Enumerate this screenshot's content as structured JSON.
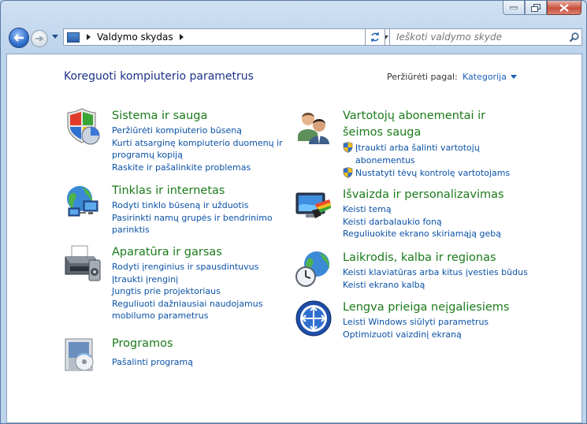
{
  "toolbar": {
    "address_segment": "Valdymo skydas",
    "search_placeholder": "Ieškoti valdymo skyde"
  },
  "header": {
    "title": "Koreguoti kompiuterio parametrus",
    "view_by_label": "Peržiūrėti pagal:",
    "view_by_value": "Kategorija"
  },
  "categories": [
    {
      "title": "Sistema ir sauga",
      "icon": "shield-pie-icon",
      "links": [
        "Peržiūrėti kompiuterio būseną",
        "Kurti atsarginę kompiuterio duomenų ir",
        "programų kopiją",
        "Raskite ir pašalinkite problemas"
      ]
    },
    {
      "title": "Tinklas ir internetas",
      "icon": "network-globe-icon",
      "links": [
        "Rodyti tinklo būseną ir užduotis",
        "Pasirinkti namų grupės ir bendrinimo",
        "parinktis"
      ]
    },
    {
      "title": "Aparatūra ir garsas",
      "icon": "printer-icon",
      "links": [
        "Rodyti įrenginius ir spausdintuvus",
        "Įtraukti įrenginį",
        "Jungtis prie projektoriaus",
        "Reguliuoti dažniausiai naudojamus",
        "mobilumo parametrus"
      ]
    },
    {
      "title": "Programos",
      "icon": "programs-icon",
      "links": [
        "Pašalinti programą"
      ]
    },
    {
      "title_lines": [
        "Vartotojų abonementai ir",
        "šeimos sauga"
      ],
      "icon": "users-icon",
      "links": [
        "Įtraukti arba šalinti vartotojų",
        "abonementus",
        "Nustatyti tėvų kontrolę vartotojams"
      ]
    },
    {
      "title": "Išvaizda ir personalizavimas",
      "icon": "appearance-icon",
      "links": [
        "Keisti temą",
        "Keisti darbalaukio foną",
        "Reguliuokite ekrano skiriamąją gebą"
      ]
    },
    {
      "title": "Laikrodis, kalba ir regionas",
      "icon": "clock-globe-icon",
      "links": [
        "Keisti klaviatūras arba kitus įvesties būdus",
        "Keisti ekrano kalbą"
      ]
    },
    {
      "title": "Lengva prieiga neįgaliesiems",
      "icon": "ease-of-access-icon",
      "links": [
        "Leisti Windows siūlyti parametrus",
        "Optimizuoti vaizdinį ekraną"
      ]
    }
  ]
}
